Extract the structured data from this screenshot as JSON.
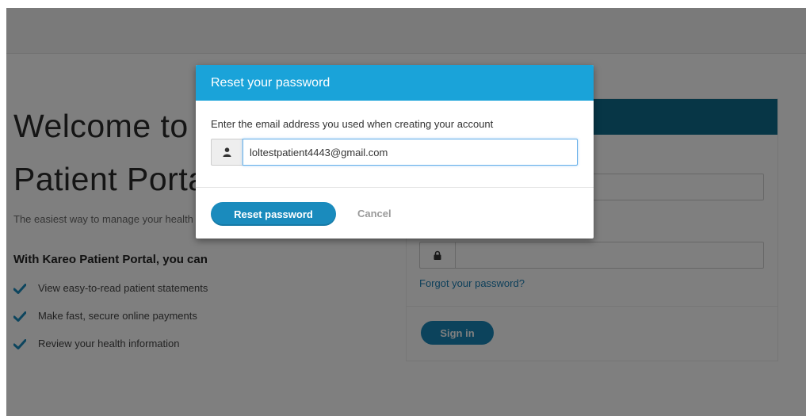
{
  "background_page": {
    "welcome_line1": "Welcome to",
    "welcome_line2": "Patient Portal",
    "tagline": "The easiest way to manage your health",
    "features_heading": "With Kareo Patient Portal, you can",
    "features": [
      {
        "text": "View easy-to-read patient statements",
        "icon": "check-icon"
      },
      {
        "text": "Make fast, secure online payments",
        "icon": "check-icon"
      },
      {
        "text": "Review your health information",
        "icon": "check-icon"
      }
    ],
    "login": {
      "username_icon": "user-icon",
      "password_icon": "lock-icon",
      "forgot_link": "Forgot your password?",
      "signin_label": "Sign in"
    }
  },
  "modal": {
    "title": "Reset your password",
    "instruction": "Enter the email address you used when creating your account",
    "email_icon": "user-icon",
    "email_value": "loltestpatient4443@gmail.com",
    "reset_label": "Reset password",
    "cancel_label": "Cancel"
  },
  "colors": {
    "modal_header": "#1aa3d9",
    "primary_button": "#1a8bbd",
    "link": "#1a7fb5",
    "login_header": "#0e6c8c",
    "check": "#1a8bbd"
  }
}
